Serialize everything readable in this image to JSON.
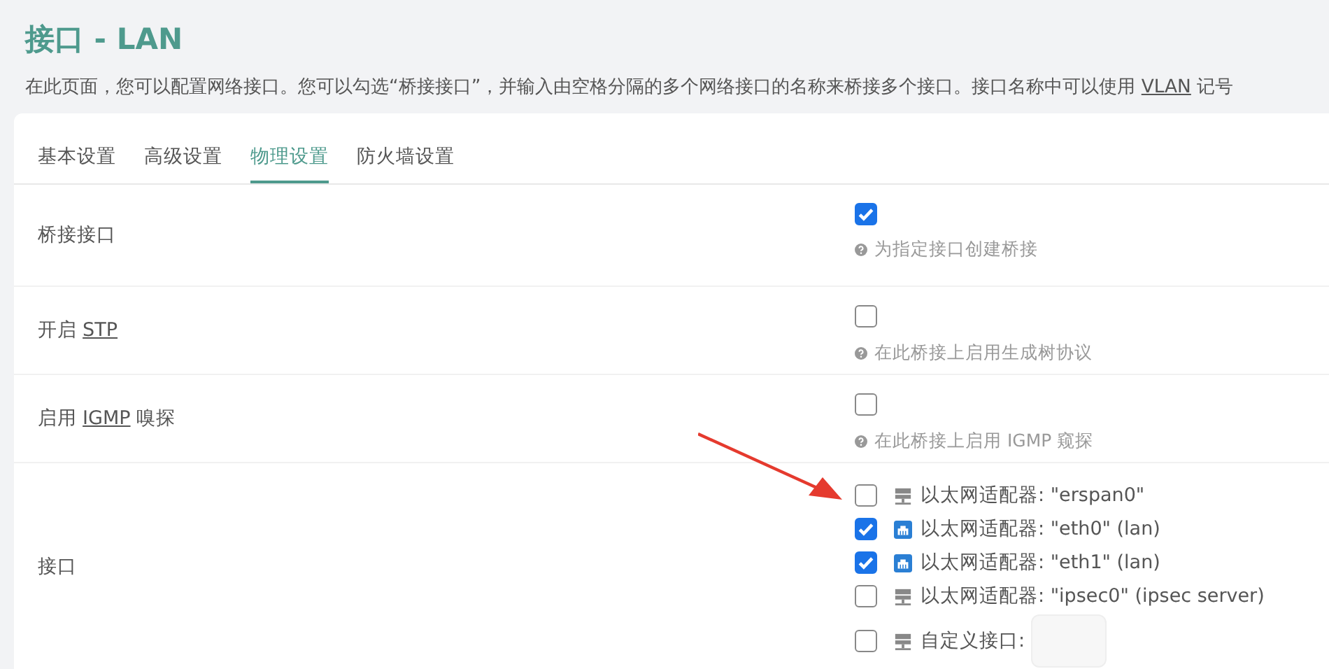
{
  "title": "接口 - LAN",
  "description": {
    "before": "在此页面，您可以配置网络接口。您可以勾选“桥接接口”，并输入由空格分隔的多个网络接口的名称来桥接多个接口。接口名称中可以使用",
    "abbr": "VLAN",
    "after": "记号"
  },
  "tabs": [
    {
      "label": "基本设置",
      "selected": false
    },
    {
      "label": "高级设置",
      "selected": false
    },
    {
      "label": "物理设置",
      "selected": true
    },
    {
      "label": "防火墙设置",
      "selected": false
    }
  ],
  "rows": [
    {
      "label": {
        "before": "桥接接口"
      },
      "kind": "checkbox",
      "checked": true,
      "help": "为指定接口创建桥接"
    },
    {
      "label": {
        "before": "开启",
        "abbr": "STP"
      },
      "kind": "checkbox",
      "checked": false,
      "help": "在此桥接上启用生成树协议"
    },
    {
      "label": {
        "before": "启用",
        "abbr": "IGMP",
        "after": "嗅探"
      },
      "kind": "checkbox",
      "checked": false,
      "help": "在此桥接上启用 IGMP 窥探"
    },
    {
      "label": {
        "before": "接口"
      },
      "kind": "interfaces",
      "options": [
        {
          "kind": "switch",
          "label": "以太网适配器: \"erspan0\"",
          "checked": false
        },
        {
          "kind": "ethernet",
          "label": "以太网适配器: \"eth0\" (lan)",
          "checked": true
        },
        {
          "kind": "ethernet",
          "label": "以太网适配器: \"eth1\" (lan)",
          "checked": true
        },
        {
          "kind": "switch",
          "label": "以太网适配器: \"ipsec0\" (ipsec server)",
          "checked": false
        },
        {
          "kind": "custom",
          "label": "自定义接口:",
          "checked": false
        }
      ]
    }
  ]
}
